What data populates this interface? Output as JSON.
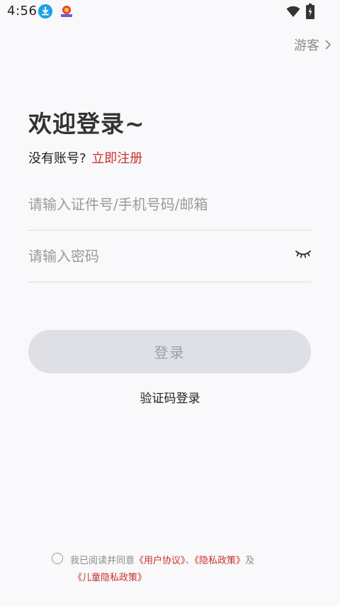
{
  "status_bar": {
    "time": "4:56",
    "icons": [
      "download-icon",
      "app-notification-icon",
      "wifi-icon",
      "battery-charging-icon"
    ]
  },
  "guest": {
    "label": "游客",
    "icon": "chevron-right-icon"
  },
  "header": {
    "title": "欢迎登录~",
    "no_account_text": "没有账号?",
    "register_link": "立即注册"
  },
  "form": {
    "account_placeholder": "请输入证件号/手机号码/邮箱",
    "password_placeholder": "请输入密码",
    "password_toggle_icon": "eye-closed-icon",
    "login_button": "登录",
    "sms_login_link": "验证码登录"
  },
  "agreement": {
    "prefix": "我已阅读并同意",
    "user_agreement": "《用户协议》",
    "separator": "、",
    "privacy_policy": "《隐私政策》",
    "and_text": "及",
    "children_privacy_policy": "《儿童隐私政策》"
  },
  "colors": {
    "accent": "#c9302c",
    "background": "#f9f9fb",
    "button_disabled_bg": "#dfe0e6",
    "button_disabled_text": "#9c9fa8"
  }
}
